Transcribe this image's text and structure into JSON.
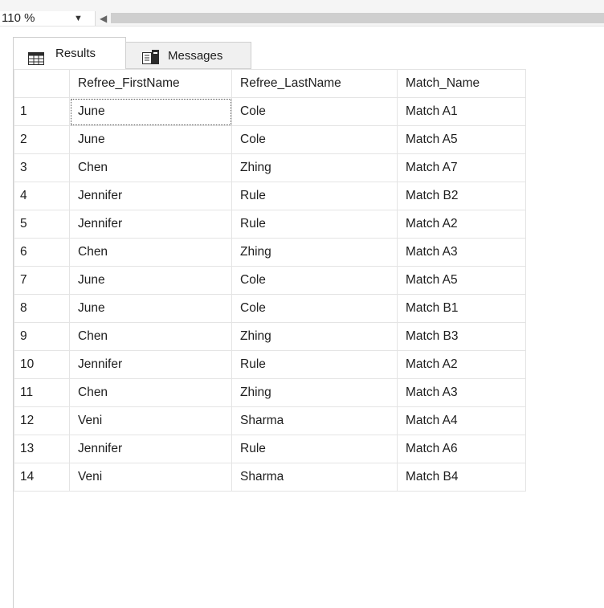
{
  "toolbar": {
    "zoom_value": "110 %",
    "zoom_arrow": "▼",
    "scroll_left_arrow": "◀"
  },
  "tabs": [
    {
      "label": "Results",
      "icon": "grid-icon",
      "active": true
    },
    {
      "label": "Messages",
      "icon": "messages-icon",
      "active": false
    }
  ],
  "results": {
    "columns": [
      "",
      "Refree_FirstName",
      "Refree_LastName",
      "Match_Name"
    ],
    "rows": [
      [
        "1",
        "June",
        "Cole",
        "Match A1"
      ],
      [
        "2",
        "June",
        "Cole",
        "Match A5"
      ],
      [
        "3",
        "Chen",
        "Zhing",
        "Match A7"
      ],
      [
        "4",
        "Jennifer",
        "Rule",
        "Match B2"
      ],
      [
        "5",
        "Jennifer",
        "Rule",
        "Match A2"
      ],
      [
        "6",
        "Chen",
        "Zhing",
        "Match A3"
      ],
      [
        "7",
        "June",
        "Cole",
        "Match A5"
      ],
      [
        "8",
        "June",
        "Cole",
        "Match B1"
      ],
      [
        "9",
        "Chen",
        "Zhing",
        "Match B3"
      ],
      [
        "10",
        "Jennifer",
        "Rule",
        "Match A2"
      ],
      [
        "11",
        "Chen",
        "Zhing",
        "Match A3"
      ],
      [
        "12",
        "Veni",
        "Sharma",
        "Match A4"
      ],
      [
        "13",
        "Jennifer",
        "Rule",
        "Match A6"
      ],
      [
        "14",
        "Veni",
        "Sharma",
        "Match B4"
      ]
    ],
    "selected_cell": {
      "row": 0,
      "col": 1
    }
  }
}
